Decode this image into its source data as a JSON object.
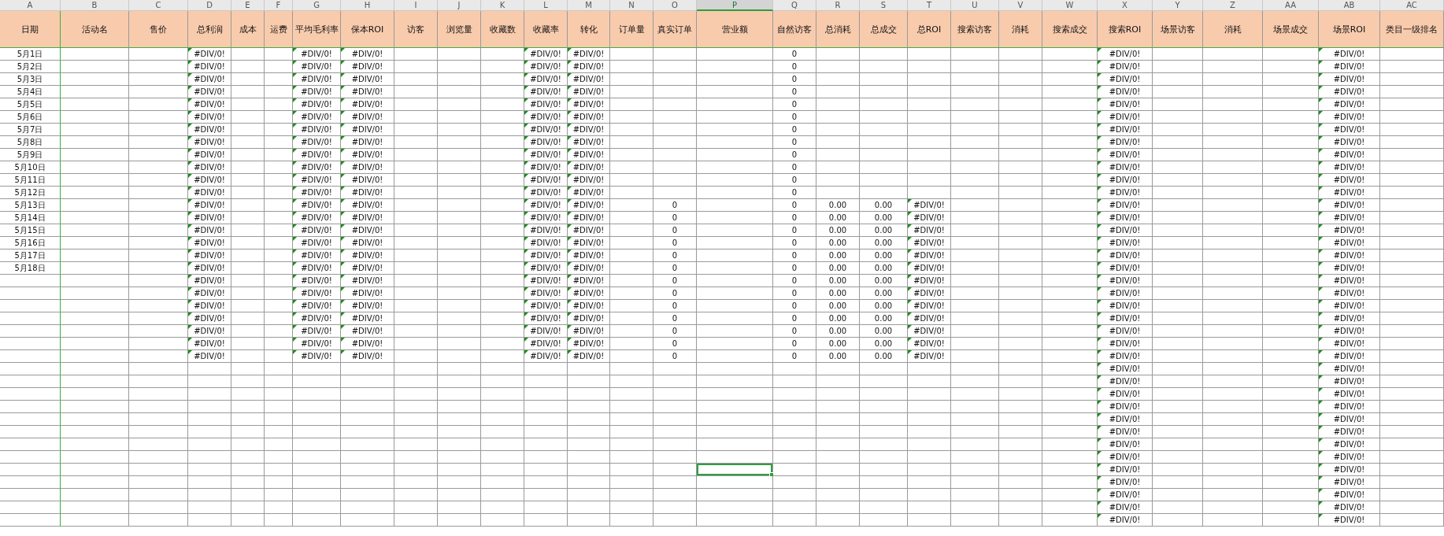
{
  "columns": [
    {
      "letter": "A",
      "header": "日期",
      "selected": false,
      "flagged": false
    },
    {
      "letter": "B",
      "header": "活动名",
      "selected": false,
      "flagged": false
    },
    {
      "letter": "C",
      "header": "售价",
      "selected": false,
      "flagged": false
    },
    {
      "letter": "D",
      "header": "总利润",
      "selected": false,
      "flagged": true
    },
    {
      "letter": "E",
      "header": "成本",
      "selected": false,
      "flagged": false
    },
    {
      "letter": "F",
      "header": "运费",
      "selected": false,
      "flagged": false
    },
    {
      "letter": "G",
      "header": "平均毛利率",
      "selected": false,
      "flagged": true
    },
    {
      "letter": "H",
      "header": "保本ROI",
      "selected": false,
      "flagged": true
    },
    {
      "letter": "I",
      "header": "访客",
      "selected": false,
      "flagged": false
    },
    {
      "letter": "J",
      "header": "浏览量",
      "selected": false,
      "flagged": false
    },
    {
      "letter": "K",
      "header": "收藏数",
      "selected": false,
      "flagged": false
    },
    {
      "letter": "L",
      "header": "收藏率",
      "selected": false,
      "flagged": true
    },
    {
      "letter": "M",
      "header": "转化",
      "selected": false,
      "flagged": true
    },
    {
      "letter": "N",
      "header": "订单量",
      "selected": false,
      "flagged": false
    },
    {
      "letter": "O",
      "header": "真实订单",
      "selected": false,
      "flagged": false
    },
    {
      "letter": "P",
      "header": "营业额",
      "selected": true,
      "flagged": false
    },
    {
      "letter": "Q",
      "header": "自然访客",
      "selected": false,
      "flagged": false
    },
    {
      "letter": "R",
      "header": "总消耗",
      "selected": false,
      "flagged": false
    },
    {
      "letter": "S",
      "header": "总成交",
      "selected": false,
      "flagged": false
    },
    {
      "letter": "T",
      "header": "总ROI",
      "selected": false,
      "flagged": true
    },
    {
      "letter": "U",
      "header": "搜索访客",
      "selected": false,
      "flagged": false
    },
    {
      "letter": "V",
      "header": "消耗",
      "selected": false,
      "flagged": false
    },
    {
      "letter": "W",
      "header": "搜索成交",
      "selected": false,
      "flagged": false
    },
    {
      "letter": "X",
      "header": "搜索ROI",
      "selected": false,
      "flagged": true
    },
    {
      "letter": "Y",
      "header": "场景访客",
      "selected": false,
      "flagged": false
    },
    {
      "letter": "Z",
      "header": "消耗",
      "selected": false,
      "flagged": false
    },
    {
      "letter": "AA",
      "header": "场景成交",
      "selected": false,
      "flagged": false
    },
    {
      "letter": "AB",
      "header": "场景ROI",
      "selected": false,
      "flagged": true
    },
    {
      "letter": "AC",
      "header": "类目一级排名",
      "selected": false,
      "flagged": false
    }
  ],
  "rows": [
    {
      "selected": false,
      "cells": {
        "A": "5月1日",
        "D": "#DIV/0!",
        "G": "#DIV/0!",
        "H": "#DIV/0!",
        "L": "#DIV/0!",
        "M": "#DIV/0!",
        "Q": "0",
        "X": "#DIV/0!",
        "AB": "#DIV/0!"
      }
    },
    {
      "selected": false,
      "cells": {
        "A": "5月2日",
        "D": "#DIV/0!",
        "G": "#DIV/0!",
        "H": "#DIV/0!",
        "L": "#DIV/0!",
        "M": "#DIV/0!",
        "Q": "0",
        "X": "#DIV/0!",
        "AB": "#DIV/0!"
      }
    },
    {
      "selected": false,
      "cells": {
        "A": "5月3日",
        "D": "#DIV/0!",
        "G": "#DIV/0!",
        "H": "#DIV/0!",
        "L": "#DIV/0!",
        "M": "#DIV/0!",
        "Q": "0",
        "X": "#DIV/0!",
        "AB": "#DIV/0!"
      }
    },
    {
      "selected": false,
      "cells": {
        "A": "5月4日",
        "D": "#DIV/0!",
        "G": "#DIV/0!",
        "H": "#DIV/0!",
        "L": "#DIV/0!",
        "M": "#DIV/0!",
        "Q": "0",
        "X": "#DIV/0!",
        "AB": "#DIV/0!"
      }
    },
    {
      "selected": false,
      "cells": {
        "A": "5月5日",
        "D": "#DIV/0!",
        "G": "#DIV/0!",
        "H": "#DIV/0!",
        "L": "#DIV/0!",
        "M": "#DIV/0!",
        "Q": "0",
        "X": "#DIV/0!",
        "AB": "#DIV/0!"
      }
    },
    {
      "selected": false,
      "cells": {
        "A": "5月6日",
        "D": "#DIV/0!",
        "G": "#DIV/0!",
        "H": "#DIV/0!",
        "L": "#DIV/0!",
        "M": "#DIV/0!",
        "Q": "0",
        "X": "#DIV/0!",
        "AB": "#DIV/0!"
      }
    },
    {
      "selected": false,
      "cells": {
        "A": "5月7日",
        "D": "#DIV/0!",
        "G": "#DIV/0!",
        "H": "#DIV/0!",
        "L": "#DIV/0!",
        "M": "#DIV/0!",
        "Q": "0",
        "X": "#DIV/0!",
        "AB": "#DIV/0!"
      }
    },
    {
      "selected": false,
      "cells": {
        "A": "5月8日",
        "D": "#DIV/0!",
        "G": "#DIV/0!",
        "H": "#DIV/0!",
        "L": "#DIV/0!",
        "M": "#DIV/0!",
        "Q": "0",
        "X": "#DIV/0!",
        "AB": "#DIV/0!"
      }
    },
    {
      "selected": false,
      "cells": {
        "A": "5月9日",
        "D": "#DIV/0!",
        "G": "#DIV/0!",
        "H": "#DIV/0!",
        "L": "#DIV/0!",
        "M": "#DIV/0!",
        "Q": "0",
        "X": "#DIV/0!",
        "AB": "#DIV/0!"
      }
    },
    {
      "selected": false,
      "cells": {
        "A": "5月10日",
        "D": "#DIV/0!",
        "G": "#DIV/0!",
        "H": "#DIV/0!",
        "L": "#DIV/0!",
        "M": "#DIV/0!",
        "Q": "0",
        "X": "#DIV/0!",
        "AB": "#DIV/0!"
      }
    },
    {
      "selected": false,
      "cells": {
        "A": "5月11日",
        "D": "#DIV/0!",
        "G": "#DIV/0!",
        "H": "#DIV/0!",
        "L": "#DIV/0!",
        "M": "#DIV/0!",
        "Q": "0",
        "X": "#DIV/0!",
        "AB": "#DIV/0!"
      }
    },
    {
      "selected": false,
      "cells": {
        "A": "5月12日",
        "D": "#DIV/0!",
        "G": "#DIV/0!",
        "H": "#DIV/0!",
        "L": "#DIV/0!",
        "M": "#DIV/0!",
        "Q": "0",
        "X": "#DIV/0!",
        "AB": "#DIV/0!"
      }
    },
    {
      "selected": false,
      "cells": {
        "A": "5月13日",
        "D": "#DIV/0!",
        "G": "#DIV/0!",
        "H": "#DIV/0!",
        "L": "#DIV/0!",
        "M": "#DIV/0!",
        "O": "0",
        "Q": "0",
        "R": "0.00",
        "S": "0.00",
        "T": "#DIV/0!",
        "X": "#DIV/0!",
        "AB": "#DIV/0!"
      }
    },
    {
      "selected": false,
      "cells": {
        "A": "5月14日",
        "D": "#DIV/0!",
        "G": "#DIV/0!",
        "H": "#DIV/0!",
        "L": "#DIV/0!",
        "M": "#DIV/0!",
        "O": "0",
        "Q": "0",
        "R": "0.00",
        "S": "0.00",
        "T": "#DIV/0!",
        "X": "#DIV/0!",
        "AB": "#DIV/0!"
      }
    },
    {
      "selected": false,
      "cells": {
        "A": "5月15日",
        "D": "#DIV/0!",
        "G": "#DIV/0!",
        "H": "#DIV/0!",
        "L": "#DIV/0!",
        "M": "#DIV/0!",
        "O": "0",
        "Q": "0",
        "R": "0.00",
        "S": "0.00",
        "T": "#DIV/0!",
        "X": "#DIV/0!",
        "AB": "#DIV/0!"
      }
    },
    {
      "selected": false,
      "cells": {
        "A": "5月16日",
        "D": "#DIV/0!",
        "G": "#DIV/0!",
        "H": "#DIV/0!",
        "L": "#DIV/0!",
        "M": "#DIV/0!",
        "O": "0",
        "Q": "0",
        "R": "0.00",
        "S": "0.00",
        "T": "#DIV/0!",
        "X": "#DIV/0!",
        "AB": "#DIV/0!"
      }
    },
    {
      "selected": false,
      "cells": {
        "A": "5月17日",
        "D": "#DIV/0!",
        "G": "#DIV/0!",
        "H": "#DIV/0!",
        "L": "#DIV/0!",
        "M": "#DIV/0!",
        "O": "0",
        "Q": "0",
        "R": "0.00",
        "S": "0.00",
        "T": "#DIV/0!",
        "X": "#DIV/0!",
        "AB": "#DIV/0!"
      }
    },
    {
      "selected": false,
      "cells": {
        "A": "5月18日",
        "D": "#DIV/0!",
        "G": "#DIV/0!",
        "H": "#DIV/0!",
        "L": "#DIV/0!",
        "M": "#DIV/0!",
        "O": "0",
        "Q": "0",
        "R": "0.00",
        "S": "0.00",
        "T": "#DIV/0!",
        "X": "#DIV/0!",
        "AB": "#DIV/0!"
      }
    },
    {
      "selected": false,
      "cells": {
        "D": "#DIV/0!",
        "G": "#DIV/0!",
        "H": "#DIV/0!",
        "L": "#DIV/0!",
        "M": "#DIV/0!",
        "O": "0",
        "Q": "0",
        "R": "0.00",
        "S": "0.00",
        "T": "#DIV/0!",
        "X": "#DIV/0!",
        "AB": "#DIV/0!"
      }
    },
    {
      "selected": false,
      "cells": {
        "D": "#DIV/0!",
        "G": "#DIV/0!",
        "H": "#DIV/0!",
        "L": "#DIV/0!",
        "M": "#DIV/0!",
        "O": "0",
        "Q": "0",
        "R": "0.00",
        "S": "0.00",
        "T": "#DIV/0!",
        "X": "#DIV/0!",
        "AB": "#DIV/0!"
      }
    },
    {
      "selected": false,
      "cells": {
        "D": "#DIV/0!",
        "G": "#DIV/0!",
        "H": "#DIV/0!",
        "L": "#DIV/0!",
        "M": "#DIV/0!",
        "O": "0",
        "Q": "0",
        "R": "0.00",
        "S": "0.00",
        "T": "#DIV/0!",
        "X": "#DIV/0!",
        "AB": "#DIV/0!"
      }
    },
    {
      "selected": false,
      "cells": {
        "D": "#DIV/0!",
        "G": "#DIV/0!",
        "H": "#DIV/0!",
        "L": "#DIV/0!",
        "M": "#DIV/0!",
        "O": "0",
        "Q": "0",
        "R": "0.00",
        "S": "0.00",
        "T": "#DIV/0!",
        "X": "#DIV/0!",
        "AB": "#DIV/0!"
      }
    },
    {
      "selected": false,
      "cells": {
        "D": "#DIV/0!",
        "G": "#DIV/0!",
        "H": "#DIV/0!",
        "L": "#DIV/0!",
        "M": "#DIV/0!",
        "O": "0",
        "Q": "0",
        "R": "0.00",
        "S": "0.00",
        "T": "#DIV/0!",
        "X": "#DIV/0!",
        "AB": "#DIV/0!"
      }
    },
    {
      "selected": false,
      "cells": {
        "D": "#DIV/0!",
        "G": "#DIV/0!",
        "H": "#DIV/0!",
        "L": "#DIV/0!",
        "M": "#DIV/0!",
        "O": "0",
        "Q": "0",
        "R": "0.00",
        "S": "0.00",
        "T": "#DIV/0!",
        "X": "#DIV/0!",
        "AB": "#DIV/0!"
      }
    },
    {
      "selected": false,
      "cells": {
        "D": "#DIV/0!",
        "G": "#DIV/0!",
        "H": "#DIV/0!",
        "L": "#DIV/0!",
        "M": "#DIV/0!",
        "O": "0",
        "Q": "0",
        "R": "0.00",
        "S": "0.00",
        "T": "#DIV/0!",
        "X": "#DIV/0!",
        "AB": "#DIV/0!"
      }
    },
    {
      "selected": false,
      "cells": {
        "X": "#DIV/0!",
        "AB": "#DIV/0!"
      }
    },
    {
      "selected": false,
      "cells": {
        "X": "#DIV/0!",
        "AB": "#DIV/0!"
      }
    },
    {
      "selected": false,
      "cells": {
        "X": "#DIV/0!",
        "AB": "#DIV/0!"
      }
    },
    {
      "selected": false,
      "cells": {
        "X": "#DIV/0!",
        "AB": "#DIV/0!"
      }
    },
    {
      "selected": false,
      "cells": {
        "X": "#DIV/0!",
        "AB": "#DIV/0!"
      }
    },
    {
      "selected": false,
      "cells": {
        "X": "#DIV/0!",
        "AB": "#DIV/0!"
      }
    },
    {
      "selected": false,
      "cells": {
        "X": "#DIV/0!",
        "AB": "#DIV/0!"
      }
    },
    {
      "selected": false,
      "cells": {
        "X": "#DIV/0!",
        "AB": "#DIV/0!"
      }
    },
    {
      "selected": true,
      "cells": {
        "X": "#DIV/0!",
        "AB": "#DIV/0!"
      }
    },
    {
      "selected": false,
      "cells": {
        "X": "#DIV/0!",
        "AB": "#DIV/0!"
      }
    },
    {
      "selected": false,
      "cells": {
        "X": "#DIV/0!",
        "AB": "#DIV/0!"
      }
    },
    {
      "selected": false,
      "cells": {
        "X": "#DIV/0!",
        "AB": "#DIV/0!"
      }
    },
    {
      "selected": false,
      "cells": {
        "X": "#DIV/0!",
        "AB": "#DIV/0!"
      }
    }
  ]
}
